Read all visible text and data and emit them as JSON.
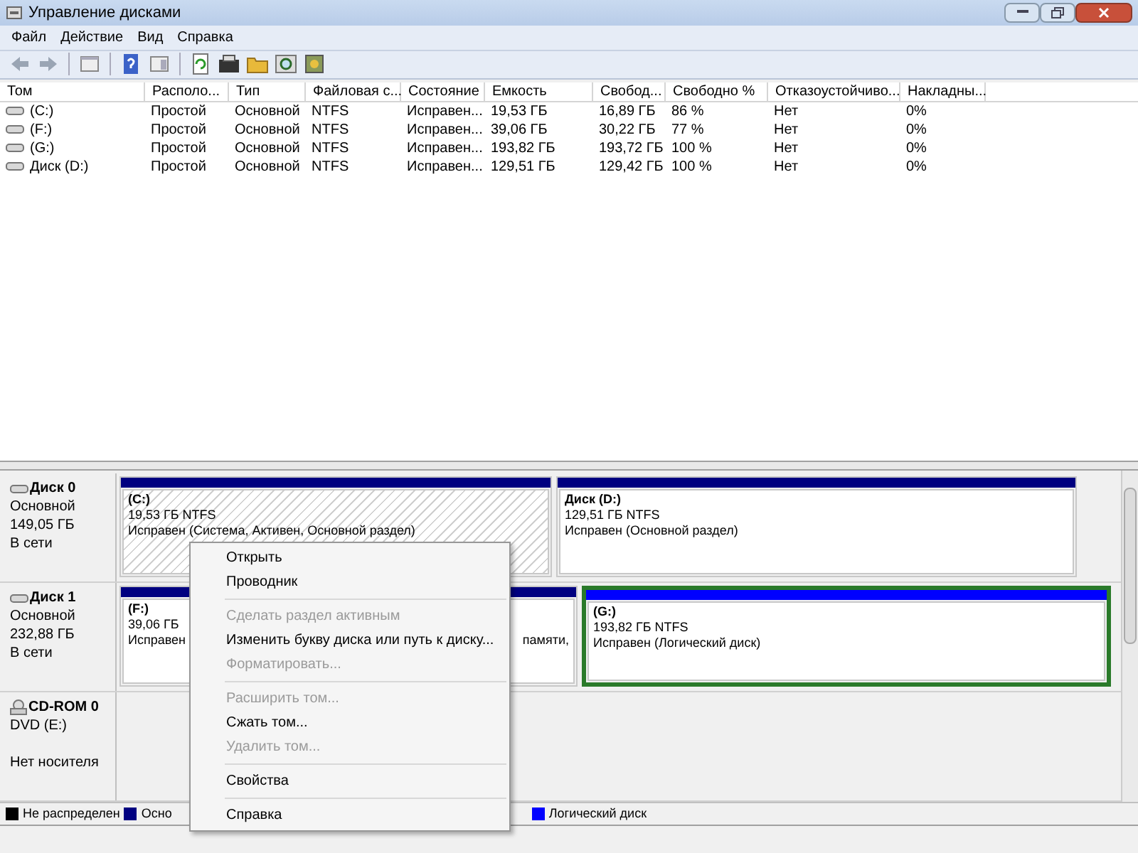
{
  "window": {
    "title": "Управление дисками"
  },
  "menu": [
    "Файл",
    "Действие",
    "Вид",
    "Справка"
  ],
  "table": {
    "columns": [
      "Том",
      "Располо...",
      "Тип",
      "Файловая с...",
      "Состояние",
      "Емкость",
      "Свобод...",
      "Свободно %",
      "Отказоустойчиво...",
      "Накладны..."
    ],
    "rows": [
      [
        "(C:)",
        "Простой",
        "Основной",
        "NTFS",
        "Исправен...",
        "19,53 ГБ",
        "16,89 ГБ",
        "86 %",
        "Нет",
        "0%"
      ],
      [
        "(F:)",
        "Простой",
        "Основной",
        "NTFS",
        "Исправен...",
        "39,06 ГБ",
        "30,22 ГБ",
        "77 %",
        "Нет",
        "0%"
      ],
      [
        "(G:)",
        "Простой",
        "Основной",
        "NTFS",
        "Исправен...",
        "193,82 ГБ",
        "193,72 ГБ",
        "100 %",
        "Нет",
        "0%"
      ],
      [
        "Диск (D:)",
        "Простой",
        "Основной",
        "NTFS",
        "Исправен...",
        "129,51 ГБ",
        "129,42 ГБ",
        "100 %",
        "Нет",
        "0%"
      ]
    ]
  },
  "disks": [
    {
      "kind": "disk",
      "name": "Диск 0",
      "lines": [
        "Основной",
        "149,05 ГБ"
      ],
      "status": "В сети",
      "partitions": [
        {
          "title": "(C:)",
          "lines": [
            "19,53 ГБ NTFS",
            "Исправен (Система, Активен, Основной раздел)"
          ],
          "color": "#000080",
          "selected": false,
          "hatched": true
        },
        {
          "title": "Диск  (D:)",
          "lines": [
            "129,51 ГБ NTFS",
            "Исправен (Основной раздел)"
          ],
          "color": "#000080",
          "selected": false,
          "hatched": false
        }
      ]
    },
    {
      "kind": "disk",
      "name": "Диск 1",
      "lines": [
        "Основной",
        "232,88 ГБ"
      ],
      "status": "В сети",
      "partitions": [
        {
          "title": "(F:)",
          "lines": [
            "39,06 ГБ",
            "Исправен"
          ],
          "tail": "памяти,",
          "color": "#000080",
          "selected": false,
          "hatched": false
        },
        {
          "title": "(G:)",
          "lines": [
            "193,82 ГБ NTFS",
            "Исправен (Логический диск)"
          ],
          "color": "#0000ff",
          "selected": true,
          "hatched": false
        }
      ]
    },
    {
      "kind": "cdrom",
      "name": "CD-ROM 0",
      "lines": [
        "DVD (E:)"
      ],
      "status": "Нет носителя"
    }
  ],
  "legend": [
    {
      "label": "Не распределен",
      "color": "#000000"
    },
    {
      "label": "Осно",
      "color": "#000080"
    },
    {
      "label": "Логический диск",
      "color": "#0000ff"
    }
  ],
  "context_menu": [
    {
      "kind": "item",
      "label": "Открыть",
      "disabled": false
    },
    {
      "kind": "item",
      "label": "Проводник",
      "disabled": false
    },
    {
      "kind": "separator"
    },
    {
      "kind": "item",
      "label": "Сделать раздел активным",
      "disabled": true
    },
    {
      "kind": "item",
      "label": "Изменить букву диска или путь к диску...",
      "disabled": false
    },
    {
      "kind": "item",
      "label": "Форматировать...",
      "disabled": true
    },
    {
      "kind": "separator"
    },
    {
      "kind": "item",
      "label": "Расширить том...",
      "disabled": true
    },
    {
      "kind": "item",
      "label": "Сжать том...",
      "disabled": false
    },
    {
      "kind": "item",
      "label": "Удалить том...",
      "disabled": true
    },
    {
      "kind": "separator"
    },
    {
      "kind": "item",
      "label": "Свойства",
      "disabled": false
    },
    {
      "kind": "separator"
    },
    {
      "kind": "item",
      "label": "Справка",
      "disabled": false
    }
  ]
}
